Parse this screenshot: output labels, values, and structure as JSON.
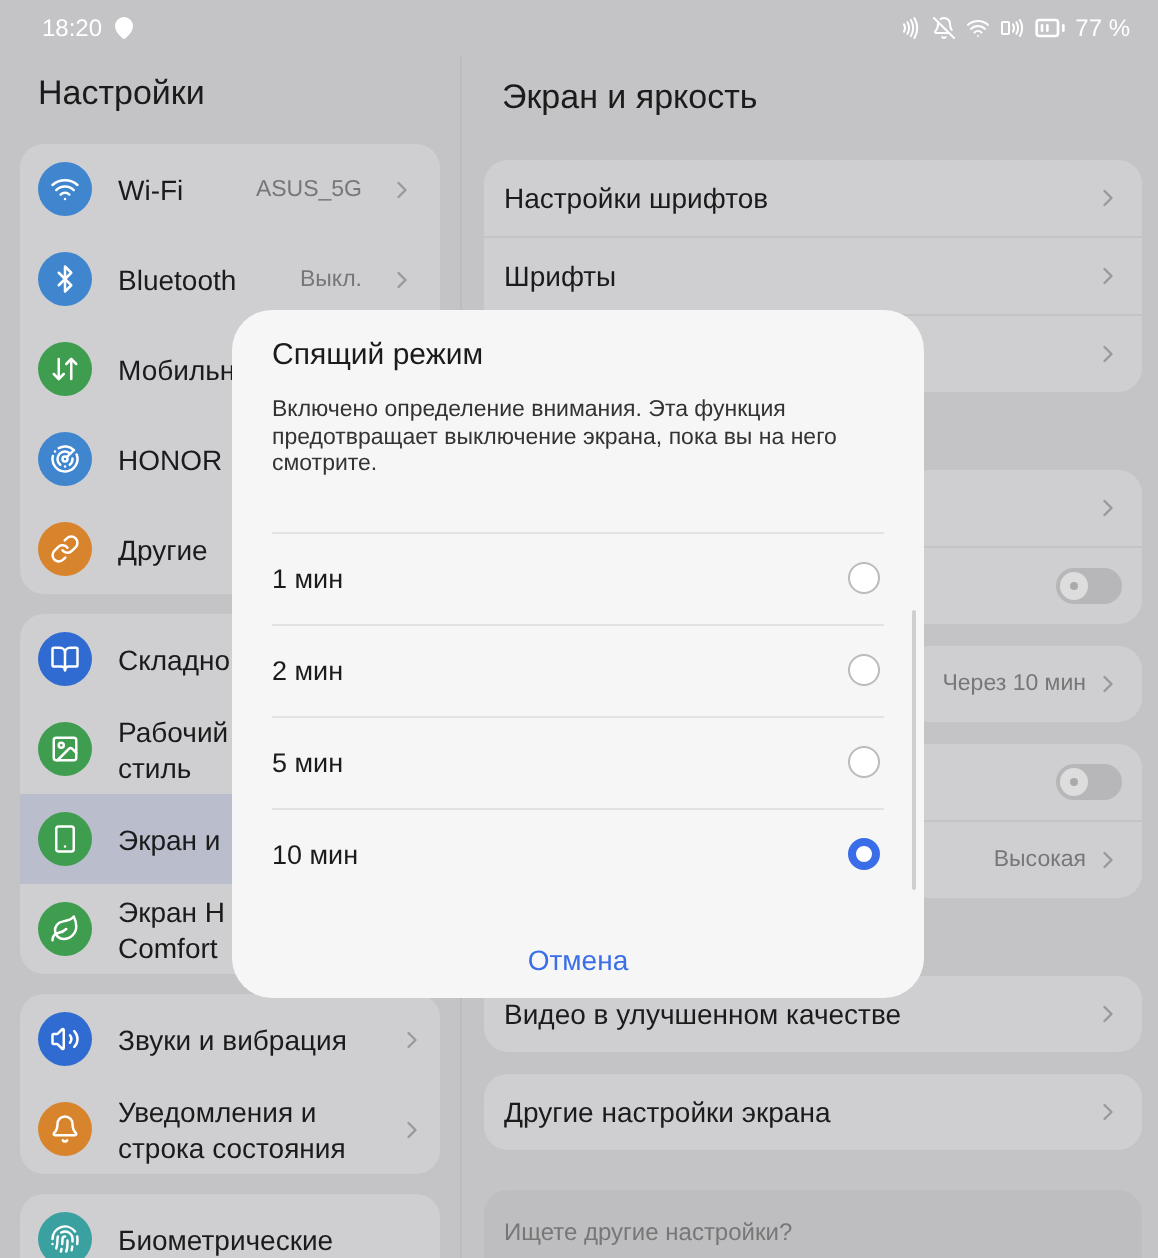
{
  "status_bar": {
    "time": "18:20",
    "battery": "77 %"
  },
  "sidebar": {
    "title": "Настройки",
    "groups": [
      {
        "items": [
          {
            "label": [
              "Wi-Fi"
            ],
            "value": "ASUS_5G",
            "kind": "link",
            "selected": false,
            "color": "#3f86cf"
          },
          {
            "label": [
              "Bluetooth"
            ],
            "value": "Выкл.",
            "kind": "link",
            "selected": false,
            "color": "#3f86cf"
          },
          {
            "label": [
              "Мобильн"
            ],
            "kind": "plain",
            "selected": false,
            "color": "#3f9d4f"
          },
          {
            "label": [
              "HONOR"
            ],
            "kind": "plain",
            "selected": false,
            "color": "#3f86cf"
          },
          {
            "label": [
              "Другие"
            ],
            "kind": "plain",
            "selected": false,
            "color": "#d8842c"
          }
        ]
      },
      {
        "items": [
          {
            "label": [
              "Складно"
            ],
            "kind": "plain",
            "selected": false,
            "color": "#2f6bd0"
          },
          {
            "label": [
              "Рабочий",
              "стиль"
            ],
            "kind": "plain",
            "selected": false,
            "color": "#3f9d4f"
          },
          {
            "label": [
              "Экран и"
            ],
            "kind": "plain",
            "selected": true,
            "color": "#3f9d4f"
          },
          {
            "label": [
              "Экран Н",
              "Comfort"
            ],
            "kind": "plain",
            "selected": false,
            "color": "#3f9d4f"
          }
        ]
      },
      {
        "items": [
          {
            "label": [
              "Звуки и вибрация"
            ],
            "kind": "link",
            "selected": false,
            "color": "#2f6bd0"
          },
          {
            "label": [
              "Уведомления и",
              "строка состояния"
            ],
            "kind": "link",
            "selected": false,
            "color": "#d8842c"
          }
        ]
      },
      {
        "items": [
          {
            "label": [
              "Биометрические"
            ],
            "kind": "plain",
            "selected": false,
            "color": "#3aa0a0"
          }
        ]
      }
    ]
  },
  "content": {
    "title": "Экран и яркость",
    "groups": [
      {
        "rows": [
          {
            "label": "Настройки шрифтов",
            "kind": "chevron"
          },
          {
            "label": "Шрифты",
            "kind": "chevron"
          },
          {
            "kind": "chevron"
          }
        ]
      },
      {
        "rows": [
          {
            "kind": "chevron"
          },
          {
            "kind": "toggle",
            "on": false
          }
        ]
      },
      {
        "rows": [
          {
            "value": "Через 10 мин",
            "kind": "chevron"
          }
        ]
      },
      {
        "rows": [
          {
            "kind": "toggle",
            "on": false
          },
          {
            "value": "Высокая",
            "kind": "chevron"
          }
        ]
      },
      {
        "rows": [
          {
            "label": "Видео в улучшенном качестве",
            "kind": "chevron"
          }
        ]
      },
      {
        "rows": [
          {
            "label": "Другие настройки экрана",
            "kind": "chevron"
          }
        ]
      }
    ],
    "hint": "Ищете другие настройки?"
  },
  "dialog": {
    "title": "Спящий режим",
    "description": "Включено определение внимания. Эта функция предотвращает выключение экрана, пока вы на него смотрите.",
    "options": [
      {
        "label": "1 мин",
        "selected": false
      },
      {
        "label": "2 мин",
        "selected": false
      },
      {
        "label": "5 мин",
        "selected": false
      },
      {
        "label": "10 мин",
        "selected": true
      }
    ],
    "cancel": "Отмена"
  }
}
